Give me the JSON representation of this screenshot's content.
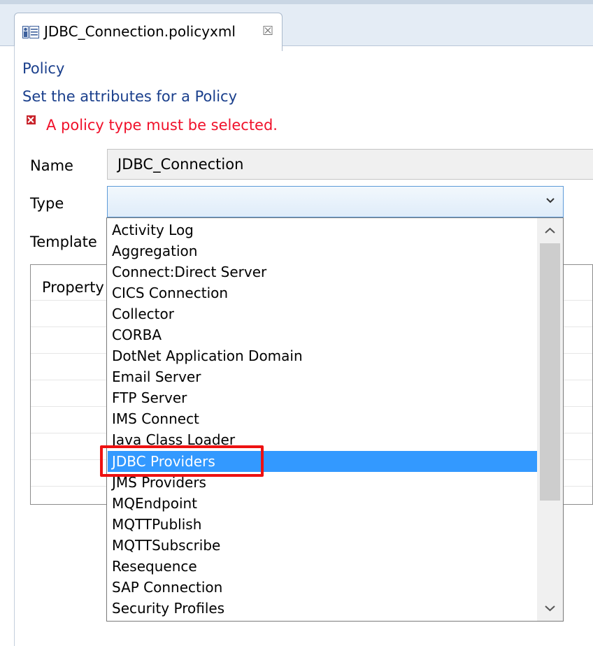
{
  "editor_tab": {
    "title": "JDBC_Connection.policyxml",
    "close_glyph": "☒",
    "icon": "policy-file-icon"
  },
  "page": {
    "title": "Policy",
    "description": "Set the attributes for a Policy",
    "error_message": "A policy type must be selected.",
    "error_icon": "error-icon",
    "error_color": "#f0102a"
  },
  "form": {
    "name_label": "Name",
    "name_value": "JDBC_Connection",
    "type_label": "Type",
    "type_value": "",
    "template_label": "Template"
  },
  "properties_table": {
    "header": "Property"
  },
  "type_dropdown": {
    "items": [
      "Activity Log",
      "Aggregation",
      "Connect:Direct Server",
      "CICS Connection",
      "Collector",
      "CORBA",
      "DotNet Application Domain",
      "Email Server",
      "FTP Server",
      "IMS Connect",
      "Java Class Loader",
      "JDBC Providers",
      "JMS Providers",
      "MQEndpoint",
      "MQTTPublish",
      "MQTTSubscribe",
      "Resequence",
      "SAP Connection",
      "Security Profiles"
    ],
    "selected": "JDBC Providers",
    "highlight_color": "#3399ff",
    "annotation_color": "#ee1111"
  }
}
